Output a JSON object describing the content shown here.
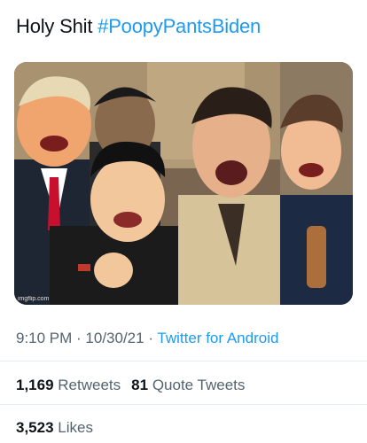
{
  "tweet": {
    "text_prefix": "Holy Shit ",
    "hashtag": "#PoopyPantsBiden"
  },
  "media": {
    "watermark": "imgflip.com"
  },
  "meta": {
    "time": "9:10 PM",
    "separator1": " · ",
    "date": "10/30/21",
    "separator2": " · ",
    "source": "Twitter for Android"
  },
  "stats": {
    "retweets_count": "1,169",
    "retweets_label": "Retweets",
    "quotes_count": "81",
    "quotes_label": "Quote Tweets",
    "likes_count": "3,523",
    "likes_label": "Likes"
  },
  "colors": {
    "link": "#1d9bf0",
    "secondary_text": "#536471",
    "primary_text": "#0f1419",
    "divider": "#e6ecf0"
  }
}
